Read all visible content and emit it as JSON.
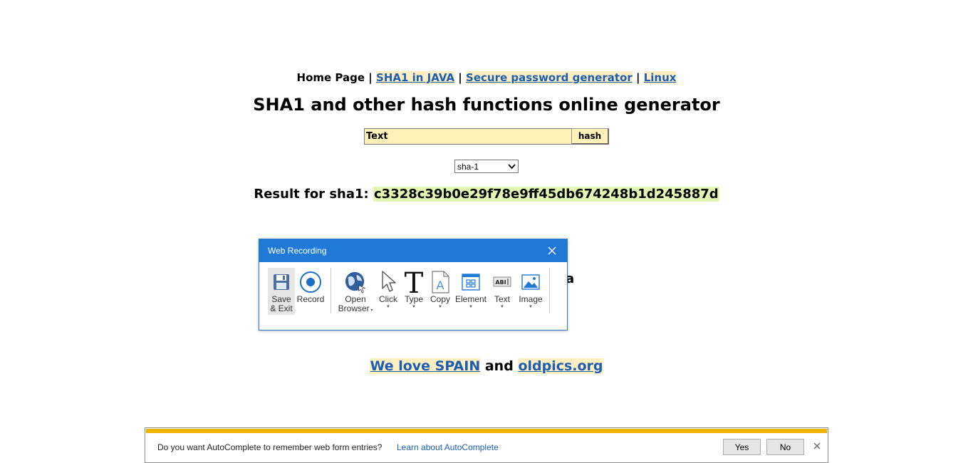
{
  "nav": {
    "home_label": "Home Page",
    "sep": "|",
    "links": [
      "SHA1 in JAVA",
      "Secure password generator",
      "Linux"
    ]
  },
  "page": {
    "title": "SHA1 and other hash functions online generator"
  },
  "hash_form": {
    "input_value": "Text",
    "button_label": "hash"
  },
  "algorithm_select": {
    "selected": "sha-1"
  },
  "result": {
    "label": "Result for sha1:",
    "value": "c3328c39b0e29f78e9ff45db674248b1d245887d"
  },
  "partial_text": "a",
  "footer": {
    "link1": "We love SPAIN",
    "conj": "and",
    "link2": "oldpics.org"
  },
  "web_recording": {
    "title": "Web Recording",
    "tools": [
      {
        "name": "save-exit",
        "label1": "Save",
        "label2": "& Exit",
        "icon": "floppy-disk-icon"
      },
      {
        "name": "record",
        "label1": "Record",
        "icon": "record-icon"
      },
      {
        "name": "open-browser",
        "label1": "Open",
        "label2": "Browser",
        "icon": "globe-icon"
      },
      {
        "name": "click",
        "label1": "Click",
        "icon": "cursor-icon"
      },
      {
        "name": "type",
        "label1": "Type",
        "icon": "type-t-icon"
      },
      {
        "name": "copy",
        "label1": "Copy",
        "icon": "document-icon"
      },
      {
        "name": "element",
        "label1": "Element",
        "icon": "element-grid-icon"
      },
      {
        "name": "text",
        "label1": "Text",
        "icon": "text-field-icon"
      },
      {
        "name": "image",
        "label1": "Image",
        "icon": "image-icon"
      }
    ]
  },
  "autocomplete_bar": {
    "message": "Do you want AutoComplete to remember web form entries?",
    "learn_link": "Learn about AutoComplete",
    "yes_label": "Yes",
    "no_label": "No"
  },
  "colors": {
    "link": "#1a5fb4",
    "link_bg": "#ffeec0",
    "hash_bg": "#e2f7b4",
    "input_bg": "#fff1b8",
    "recorder_title": "#2079d5",
    "notification_accent": "#f0b400"
  }
}
